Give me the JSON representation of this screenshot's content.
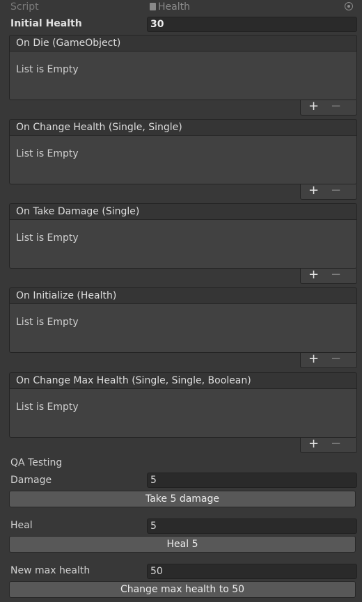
{
  "inspector": {
    "script_label": "Script",
    "script_value": "Health",
    "initial_health_label": "Initial Health",
    "initial_health_value": "30"
  },
  "events": [
    {
      "title": "On Die (GameObject)",
      "empty_text": "List is Empty",
      "add": "+",
      "remove": "−"
    },
    {
      "title": "On Change Health (Single, Single)",
      "empty_text": "List is Empty",
      "add": "+",
      "remove": "−"
    },
    {
      "title": "On Take Damage (Single)",
      "empty_text": "List is Empty",
      "add": "+",
      "remove": "−"
    },
    {
      "title": "On Initialize (Health)",
      "empty_text": "List is Empty",
      "add": "+",
      "remove": "−"
    },
    {
      "title": "On Change Max Health (Single, Single, Boolean)",
      "empty_text": "List is Empty",
      "add": "+",
      "remove": "−"
    }
  ],
  "qa": {
    "section_title": "QA Testing",
    "damage_label": "Damage",
    "damage_value": "5",
    "damage_button": "Take 5 damage",
    "heal_label": "Heal",
    "heal_value": "5",
    "heal_button": "Heal 5",
    "max_health_label": "New max health",
    "max_health_value": "50",
    "max_health_button": "Change max health to 50"
  },
  "colors": {
    "background": "#383838",
    "field_background": "#2a2a2a",
    "button_background": "#585858"
  }
}
